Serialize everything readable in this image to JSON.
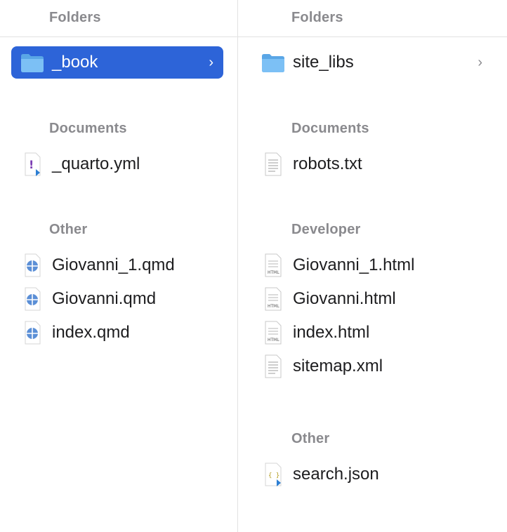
{
  "colors": {
    "selection": "#2d64d8",
    "folder": "#6cb6ef",
    "section_title": "#8a8a8e"
  },
  "left": {
    "header": "Folders",
    "folders": [
      {
        "label": "_book",
        "icon": "folder-icon",
        "selected": true
      }
    ],
    "documents_title": "Documents",
    "documents": [
      {
        "label": "_quarto.yml",
        "icon": "yml-vscode-file-icon"
      }
    ],
    "other_title": "Other",
    "other": [
      {
        "label": "Giovanni_1.qmd",
        "icon": "qmd-file-icon"
      },
      {
        "label": "Giovanni.qmd",
        "icon": "qmd-file-icon"
      },
      {
        "label": "index.qmd",
        "icon": "qmd-file-icon"
      }
    ]
  },
  "right": {
    "header": "Folders",
    "folders": [
      {
        "label": "site_libs",
        "icon": "folder-icon"
      }
    ],
    "documents_title": "Documents",
    "documents": [
      {
        "label": "robots.txt",
        "icon": "text-file-icon"
      }
    ],
    "developer_title": "Developer",
    "developer": [
      {
        "label": "Giovanni_1.html",
        "icon": "html-file-icon",
        "badge": "HTML"
      },
      {
        "label": "Giovanni.html",
        "icon": "html-file-icon",
        "badge": "HTML"
      },
      {
        "label": "index.html",
        "icon": "html-file-icon",
        "badge": "HTML"
      },
      {
        "label": "sitemap.xml",
        "icon": "text-file-icon"
      }
    ],
    "other_title": "Other",
    "other": [
      {
        "label": "search.json",
        "icon": "json-vscode-file-icon",
        "glyph": "{ }"
      }
    ]
  }
}
